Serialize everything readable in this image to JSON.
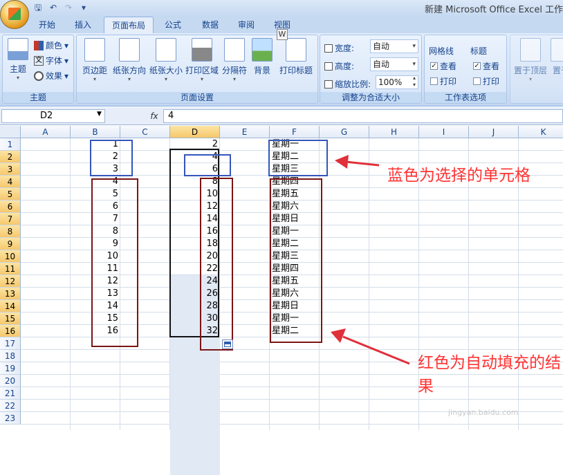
{
  "window": {
    "title": "新建 Microsoft Office Excel 工作表"
  },
  "tabs": [
    "开始",
    "插入",
    "页面布局",
    "公式",
    "数据",
    "审阅",
    "视图"
  ],
  "tab_hint": "W",
  "ribbon": {
    "theme": {
      "themes": "主题",
      "colors": "颜色",
      "fonts": "字体",
      "effects": "效果",
      "group": "主题"
    },
    "page_setup": {
      "margins": "页边距",
      "orientation": "纸张方向",
      "size": "纸张大小",
      "print_area": "打印区域",
      "breaks": "分隔符",
      "background": "背景",
      "print_titles": "打印标题",
      "group": "页面设置"
    },
    "scale_to_fit": {
      "width_label": "宽度:",
      "width_value": "自动",
      "height_label": "高度:",
      "height_value": "自动",
      "scale_label": "缩放比例:",
      "scale_value": "100%",
      "group": "调整为合适大小"
    },
    "sheet_options": {
      "gridlines": "网格线",
      "headings": "标题",
      "view": "查看",
      "print": "打印",
      "group": "工作表选项"
    },
    "arrange": {
      "bring_front": "置于顶层",
      "send_back": "置于"
    }
  },
  "formula_bar": {
    "name_box": "D2",
    "fx": "fx",
    "value": "4"
  },
  "columns": [
    "A",
    "B",
    "C",
    "D",
    "E",
    "F",
    "G",
    "H",
    "I",
    "J",
    "K"
  ],
  "rows": [
    "1",
    "2",
    "3",
    "4",
    "5",
    "6",
    "7",
    "8",
    "9",
    "10",
    "11",
    "12",
    "13",
    "14",
    "15",
    "16",
    "17",
    "18",
    "19",
    "20",
    "21",
    "22",
    "23"
  ],
  "col_b": [
    "1",
    "2",
    "3",
    "4",
    "5",
    "6",
    "7",
    "8",
    "9",
    "10",
    "11",
    "12",
    "13",
    "14",
    "15",
    "16"
  ],
  "col_d": [
    "2",
    "4",
    "6",
    "8",
    "10",
    "12",
    "14",
    "16",
    "18",
    "20",
    "22",
    "24",
    "26",
    "28",
    "30",
    "32"
  ],
  "col_f": [
    "星期一",
    "星期二",
    "星期三",
    "星期四",
    "星期五",
    "星期六",
    "星期日",
    "星期一",
    "星期二",
    "星期三",
    "星期四",
    "星期五",
    "星期六",
    "星期日",
    "星期一",
    "星期二"
  ],
  "annotations": {
    "blue_note": "蓝色为选择的单元格",
    "red_note": "红色为自动填充的结果"
  },
  "watermark": {
    "site": "jingyan.baidu.com"
  },
  "colors": {
    "blue_box": "#3355bb",
    "red_box": "#7a1414",
    "note_text": "#ff3333",
    "arrow": "#e0303a"
  }
}
